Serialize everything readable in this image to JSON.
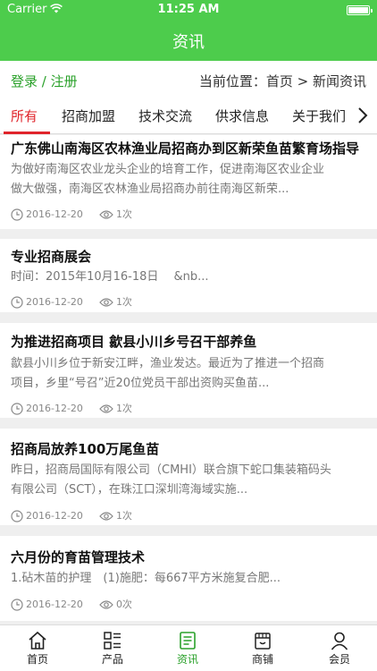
{
  "status_bar": {
    "carrier": "Carrier",
    "time": "11:25 AM"
  },
  "header": {
    "title": "资讯"
  },
  "location": {
    "login_label": "登录 / 注册",
    "breadcrumb": "当前位置：首页 > 新闻资讯"
  },
  "tabs": [
    {
      "label": "所有",
      "active": true
    },
    {
      "label": "招商加盟"
    },
    {
      "label": "技术交流"
    },
    {
      "label": "供求信息"
    },
    {
      "label": "关于我们"
    }
  ],
  "articles": [
    {
      "title": "广东佛山南海区农林渔业局招商办到区新荣鱼苗繁育场指导",
      "desc_line1": "为做好南海区农业龙头企业的培育工作，促进南海区农业企业",
      "desc_line2": "做大做强，南海区农林渔业局招商办前往南海区新荣...",
      "date": "2016-12-20",
      "views": "1次"
    },
    {
      "title": "专业招商展会",
      "desc_line1": "时间：2015年10月16-18日　 &nb...",
      "desc_line2": "",
      "date": "2016-12-20",
      "views": "1次"
    },
    {
      "title": "为推进招商项目 歙县小川乡号召干部养鱼",
      "desc_line1": "歙县小川乡位于新安江畔，渔业发达。最近为了推进一个招商",
      "desc_line2": "项目，乡里“号召”近20位党员干部出资购买鱼苗...",
      "date": "2016-12-20",
      "views": "1次"
    },
    {
      "title": "招商局放养100万尾鱼苗",
      "desc_line1": "昨日，招商局国际有限公司（CMHI）联合旗下蛇口集装箱码头",
      "desc_line2": "有限公司（SCT），在珠江口深圳湾海域实施...",
      "date": "2016-12-20",
      "views": "1次"
    },
    {
      "title": "六月份的育苗管理技术",
      "desc_line1": " 1.砧木苗的护理　(1)施肥：每667平方米施复合肥...",
      "desc_line2": "",
      "date": "2016-12-20",
      "views": "0次"
    }
  ],
  "bottom_tabs": [
    {
      "label": "首页"
    },
    {
      "label": "产品"
    },
    {
      "label": "资讯",
      "active": true
    },
    {
      "label": "商铺"
    },
    {
      "label": "会员"
    }
  ],
  "colors": {
    "brand_green": "#4dcc4c",
    "active_red": "#e0242b"
  }
}
